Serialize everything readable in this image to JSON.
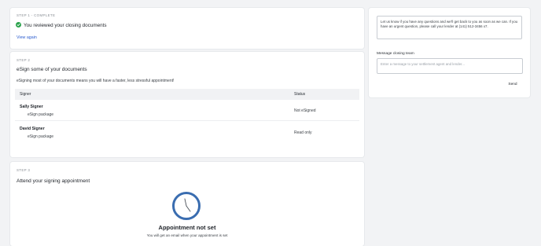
{
  "step1": {
    "label": "STEP 1 - COMPLETE",
    "status_text": "You reviewed your closing documents",
    "link_label": "View again",
    "icon": "check-circle-icon",
    "accent": "#2aa24c"
  },
  "step2": {
    "label": "STEP 2",
    "title": "eSign some of your documents",
    "subtitle": "eSigning most of your documents means you will have a faster, less stressful appointment!",
    "table": {
      "headers": [
        "Signer",
        "Status"
      ],
      "rows": [
        {
          "name": "Sally Signer",
          "package": "eSign package",
          "status": "Not eSigned"
        },
        {
          "name": "David Signer",
          "package": "eSign package",
          "status": "Read only"
        }
      ]
    }
  },
  "step3": {
    "label": "STEP 3",
    "title": "Attend your signing appointment",
    "appointment_title": "Appointment not set",
    "appointment_subtitle": "You will get an email when your appointment is set",
    "icon": "clock-icon",
    "accent": "#3a6db0"
  },
  "sidebar": {
    "message": "Let us know if you have any questions and we'll get back to you as soon as we can. If you have an urgent question, please call your lender at (141) 512-3456 x7.",
    "section_label": "Message closing team",
    "input_placeholder": "Enter a message to your settlement agent and lender...",
    "send_label": "Send"
  }
}
